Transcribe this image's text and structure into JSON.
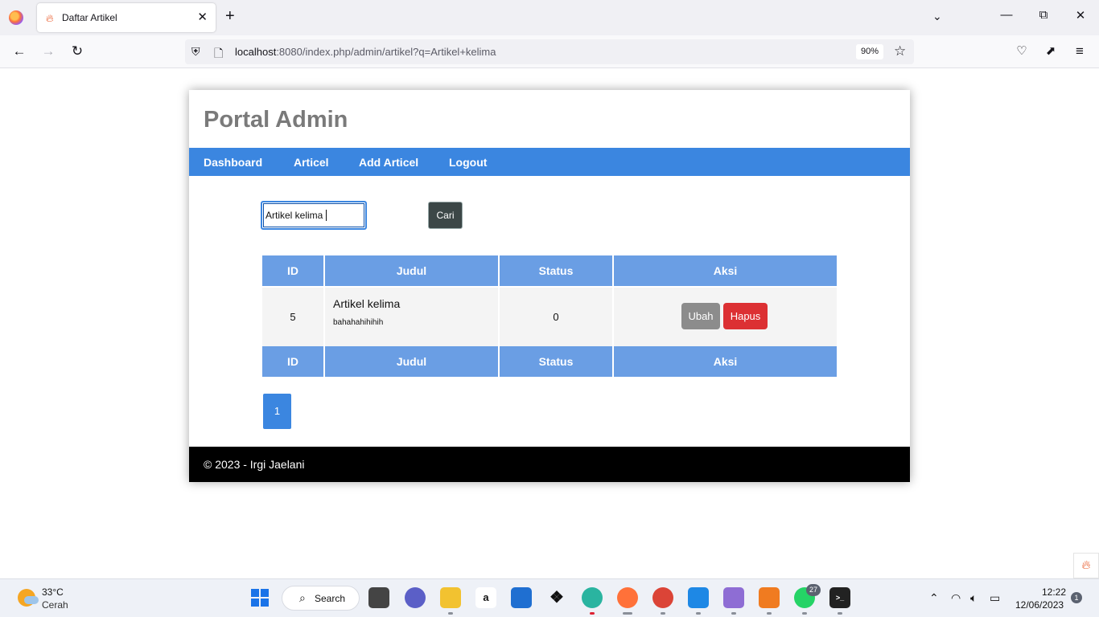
{
  "browser": {
    "tab_title": "Daftar Artikel",
    "url_host": "localhost",
    "url_rest": ":8080/index.php/admin/artikel?q=Artikel+kelima",
    "zoom": "90%"
  },
  "page": {
    "brand": "Portal Admin",
    "menu": [
      "Dashboard",
      "Articel",
      "Add Articel",
      "Logout"
    ],
    "search": {
      "value": "Artikel kelima",
      "button": "Cari"
    },
    "table": {
      "headers": [
        "ID",
        "Judul",
        "Status",
        "Aksi"
      ],
      "rows": [
        {
          "id": "5",
          "title": "Artikel kelima",
          "excerpt": "bahahahihihih",
          "status": "0",
          "edit": "Ubah",
          "delete": "Hapus"
        }
      ],
      "footers": [
        "ID",
        "Judul",
        "Status",
        "Aksi"
      ]
    },
    "pagination": [
      "1"
    ],
    "footer": "© 2023 - Irgi Jaelani"
  },
  "taskbar": {
    "temperature": "33°C",
    "weather": "Cerah",
    "search_label": "Search",
    "whatsapp_badge": "27",
    "time": "12:22",
    "date": "12/06/2023",
    "notifications": "1"
  },
  "colors": {
    "menu_bg": "#3b86e0",
    "table_header_bg": "#6a9ee4",
    "edit_btn": "#8c8c8c",
    "delete_btn": "#dc3033",
    "footer_bg": "#000000"
  }
}
